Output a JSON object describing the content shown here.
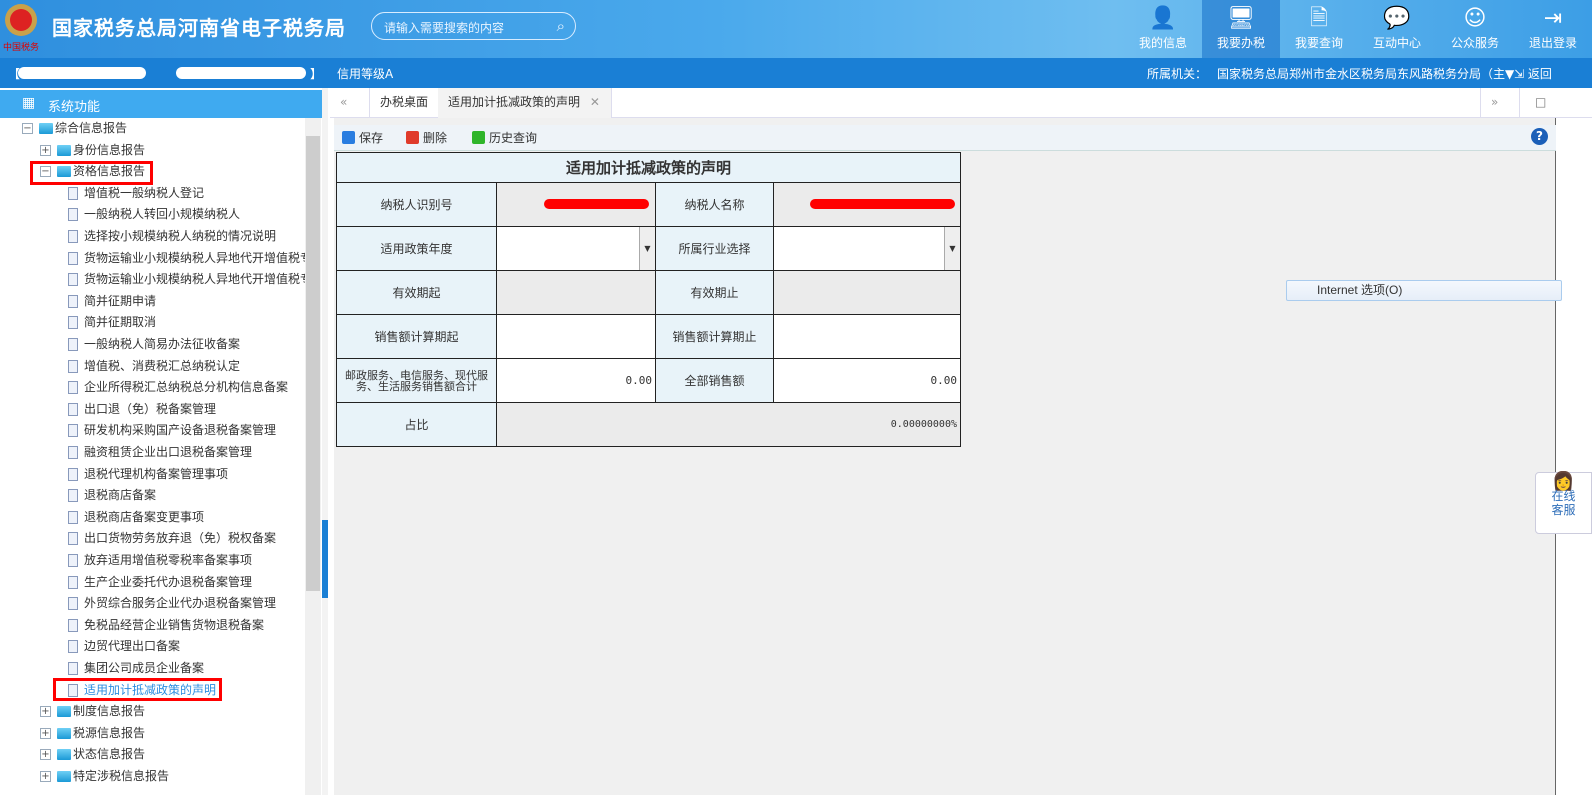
{
  "header": {
    "title": "国家税务总局河南省电子税务局",
    "search_placeholder": "请输入需要搜索的内容",
    "nav": [
      {
        "label": "我的信息",
        "icon": "user-icon"
      },
      {
        "label": "我要办税",
        "icon": "monitor-icon"
      },
      {
        "label": "我要查询",
        "icon": "document-search-icon"
      },
      {
        "label": "互动中心",
        "icon": "chat-icon"
      },
      {
        "label": "公众服务",
        "icon": "service-icon"
      },
      {
        "label": "退出登录",
        "icon": "logout-icon"
      }
    ]
  },
  "subbar": {
    "bracket_open": "【",
    "bracket_close": "】",
    "credit": "信用等级A",
    "office_label": "所属机关：",
    "office": "国家税务总局郑州市金水区税务局东风路税务分局（主",
    "back": "返回"
  },
  "sidebar": {
    "title": "系统功能",
    "tree": [
      {
        "label": "综合信息报告",
        "level": 1,
        "type": "folder-open"
      },
      {
        "label": "身份信息报告",
        "level": 2,
        "type": "folder"
      },
      {
        "label": "资格信息报告",
        "level": 2,
        "type": "folder-open"
      },
      {
        "label": "增值税一般纳税人登记",
        "level": 3
      },
      {
        "label": "一般纳税人转回小规模纳税人",
        "level": 3
      },
      {
        "label": "选择按小规模纳税人纳税的情况说明",
        "level": 3
      },
      {
        "label": "货物运输业小规模纳税人异地代开增值税专",
        "level": 3
      },
      {
        "label": "货物运输业小规模纳税人异地代开增值税专",
        "level": 3
      },
      {
        "label": "简并征期申请",
        "level": 3
      },
      {
        "label": "简并征期取消",
        "level": 3
      },
      {
        "label": "一般纳税人简易办法征收备案",
        "level": 3
      },
      {
        "label": "增值税、消费税汇总纳税认定",
        "level": 3
      },
      {
        "label": "企业所得税汇总纳税总分机构信息备案",
        "level": 3
      },
      {
        "label": "出口退（免）税备案管理",
        "level": 3
      },
      {
        "label": "研发机构采购国产设备退税备案管理",
        "level": 3
      },
      {
        "label": "融资租赁企业出口退税备案管理",
        "level": 3
      },
      {
        "label": "退税代理机构备案管理事项",
        "level": 3
      },
      {
        "label": "退税商店备案",
        "level": 3
      },
      {
        "label": "退税商店备案变更事项",
        "level": 3
      },
      {
        "label": "出口货物劳务放弃退（免）税权备案",
        "level": 3
      },
      {
        "label": "放弃适用增值税零税率备案事项",
        "level": 3
      },
      {
        "label": "生产企业委托代办退税备案管理",
        "level": 3
      },
      {
        "label": "外贸综合服务企业代办退税备案管理",
        "level": 3
      },
      {
        "label": "免税品经营企业销售货物退税备案",
        "level": 3
      },
      {
        "label": "边贸代理出口备案",
        "level": 3
      },
      {
        "label": "集团公司成员企业备案",
        "level": 3
      },
      {
        "label": "适用加计抵减政策的声明",
        "level": 3,
        "selected": true
      },
      {
        "label": "制度信息报告",
        "level": 2,
        "type": "folder"
      },
      {
        "label": "税源信息报告",
        "level": 2,
        "type": "folder"
      },
      {
        "label": "状态信息报告",
        "level": 2,
        "type": "folder"
      },
      {
        "label": "特定涉税信息报告",
        "level": 2,
        "type": "folder"
      }
    ]
  },
  "tabs": [
    {
      "label": "办税桌面"
    },
    {
      "label": "适用加计抵减政策的声明",
      "closable": true
    }
  ],
  "toolbar": {
    "save": "保存",
    "delete": "删除",
    "history": "历史查询"
  },
  "form": {
    "title": "适用加计抵减政策的声明",
    "taxpayer_id_label": "纳税人识别号",
    "taxpayer_name_label": "纳税人名称",
    "policy_year_label": "适用政策年度",
    "policy_year_value": "",
    "industry_label": "所属行业选择",
    "industry_value": "",
    "valid_from_label": "有效期起",
    "valid_to_label": "有效期止",
    "sales_from_label": "销售额计算期起",
    "sales_to_label": "销售额计算期止",
    "service_sales_label": "邮政服务、电信服务、现代服务、生活服务销售额合计",
    "service_sales_value": "0.00",
    "total_sales_label": "全部销售额",
    "total_sales_value": "0.00",
    "ratio_label": "占比",
    "ratio_value": "0.00000000%"
  },
  "context_menu": {
    "item": "Internet 选项(O)"
  },
  "online_service": {
    "line1": "在线",
    "line2": "客服"
  },
  "colors": {
    "header": "#3c9ee6",
    "subbar": "#1a7fd5",
    "sidebar_header": "#3faaf0",
    "highlight": "#ff0000",
    "label_cell": "#e8f3f9"
  }
}
